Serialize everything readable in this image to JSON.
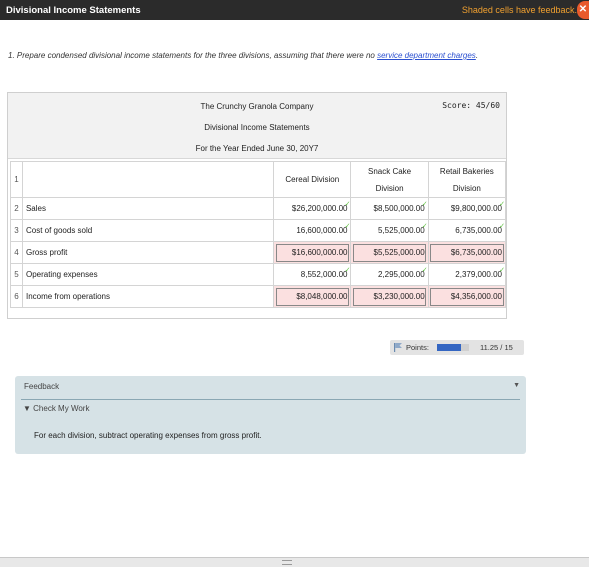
{
  "window": {
    "title": "Divisional Income Statements",
    "feedback_notice": "Shaded cells have feedback.",
    "close_glyph": "✕"
  },
  "question": {
    "text": "1. Prepare condensed divisional income statements for the three divisions, assuming that there were no ",
    "link": "service department charges",
    "end": "."
  },
  "statement": {
    "company": "The Crunchy Granola Company",
    "name": "Divisional Income Statements",
    "period": "For the Year Ended June 30, 20Y7",
    "score": "Score: 45/60"
  },
  "table": {
    "header_rownum": "1",
    "columns": {
      "c1": "Cereal Division",
      "c2a": "Snack Cake",
      "c2b": "Division",
      "c3a": "Retail Bakeries",
      "c3b": "Division"
    },
    "rows": [
      {
        "num": "2",
        "label": "Sales",
        "v1": "$26,200,000.00",
        "v2": "$8,500,000.00",
        "v3": "$9,800,000.00"
      },
      {
        "num": "3",
        "label": "Cost of goods sold",
        "v1": "16,600,000.00",
        "v2": "5,525,000.00",
        "v3": "6,735,000.00"
      },
      {
        "num": "4",
        "label": "Gross profit",
        "v1": "$16,600,000.00",
        "v2": "$5,525,000.00",
        "v3": "$6,735,000.00"
      },
      {
        "num": "5",
        "label": "Operating expenses",
        "v1": "8,552,000.00",
        "v2": "2,295,000.00",
        "v3": "2,379,000.00"
      },
      {
        "num": "6",
        "label": "Income from operations",
        "v1": "$8,048,000.00",
        "v2": "$3,230,000.00",
        "v3": "$4,356,000.00"
      }
    ]
  },
  "points": {
    "label": "Points:",
    "value": "11.25 / 15",
    "fraction": 0.75
  },
  "feedback": {
    "title": "Feedback",
    "check_label": "Check My Work",
    "text": "For each division, subtract operating expenses from gross profit."
  },
  "colors": {
    "shaded_cell": "#fbe0e0",
    "check": "#5cbf3d",
    "link": "#2a4fd0",
    "points_fill": "#3466c2"
  }
}
